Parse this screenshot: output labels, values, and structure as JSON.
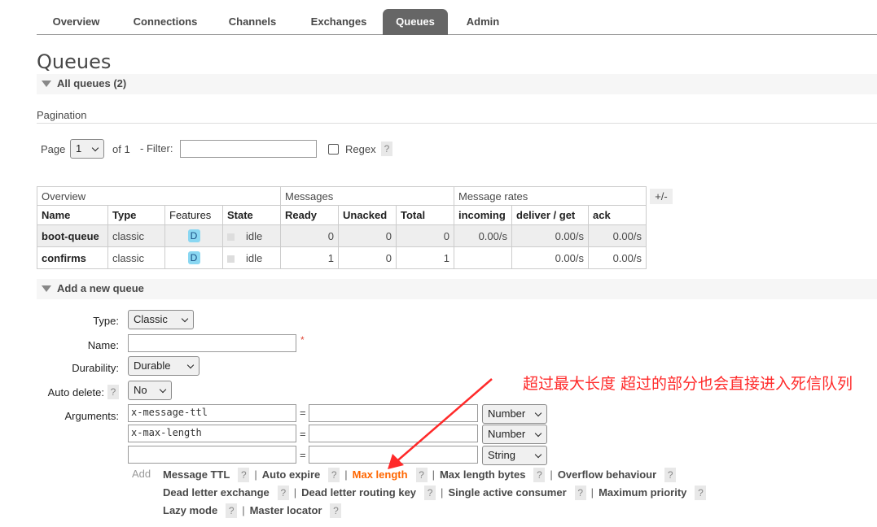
{
  "nav": {
    "tabs": [
      {
        "label": "Overview"
      },
      {
        "label": "Connections"
      },
      {
        "label": "Channels"
      },
      {
        "label": "Exchanges"
      },
      {
        "label": "Queues"
      },
      {
        "label": "Admin"
      }
    ],
    "active": "Queues"
  },
  "page_title": "Queues",
  "all_queues": {
    "label": "All queues (2)"
  },
  "pagination": {
    "label": "Pagination",
    "page_label": "Page",
    "page_value": "1",
    "of_label": "of 1",
    "filter_label": "- Filter:",
    "filter_value": "",
    "regex_label": "Regex",
    "regex_checked": false,
    "help": "?"
  },
  "table": {
    "groups": [
      "Overview",
      "Messages",
      "Message rates"
    ],
    "toggle": "+/-",
    "columns": [
      "Name",
      "Type",
      "Features",
      "State",
      "Ready",
      "Unacked",
      "Total",
      "incoming",
      "deliver / get",
      "ack"
    ],
    "rows": [
      {
        "name": "boot-queue",
        "type": "classic",
        "feature": "D",
        "state": "idle",
        "ready": "0",
        "unacked": "0",
        "total": "0",
        "incoming": "0.00/s",
        "deliver_get": "0.00/s",
        "ack": "0.00/s"
      },
      {
        "name": "confirms",
        "type": "classic",
        "feature": "D",
        "state": "idle",
        "ready": "1",
        "unacked": "0",
        "total": "1",
        "incoming": "",
        "deliver_get": "0.00/s",
        "ack": "0.00/s"
      }
    ]
  },
  "add_queue": {
    "section_label": "Add a new queue",
    "type_label": "Type:",
    "type_value": "Classic",
    "name_label": "Name:",
    "name_value": "",
    "required_mark": "*",
    "durability_label": "Durability:",
    "durability_value": "Durable",
    "auto_delete_label": "Auto delete:",
    "auto_delete_help": "?",
    "auto_delete_value": "No",
    "arguments_label": "Arguments:",
    "equals": "=",
    "arguments": [
      {
        "key": "x-message-ttl",
        "value": "",
        "type": "Number"
      },
      {
        "key": "x-max-length",
        "value": "",
        "type": "Number"
      },
      {
        "key": "",
        "value": "",
        "type": "String"
      }
    ],
    "add_label": "Add",
    "shortcut_rows": [
      [
        "Message TTL",
        "Auto expire",
        "Max length",
        "Max length bytes",
        "Overflow behaviour"
      ],
      [
        "Dead letter exchange",
        "Dead letter routing key",
        "Single active consumer",
        "Maximum priority"
      ],
      [
        "Lazy mode",
        "Master locator"
      ]
    ],
    "highlighted": "Max length",
    "help": "?",
    "separator": "|"
  },
  "annotation": {
    "text": "超过最大长度 超过的部分也会直接进入死信队列",
    "color": "#ff2a2a"
  },
  "colors": {
    "active_tab": "#666666",
    "highlight_link": "#ff6600",
    "feature_badge": "#8ad7f2"
  }
}
